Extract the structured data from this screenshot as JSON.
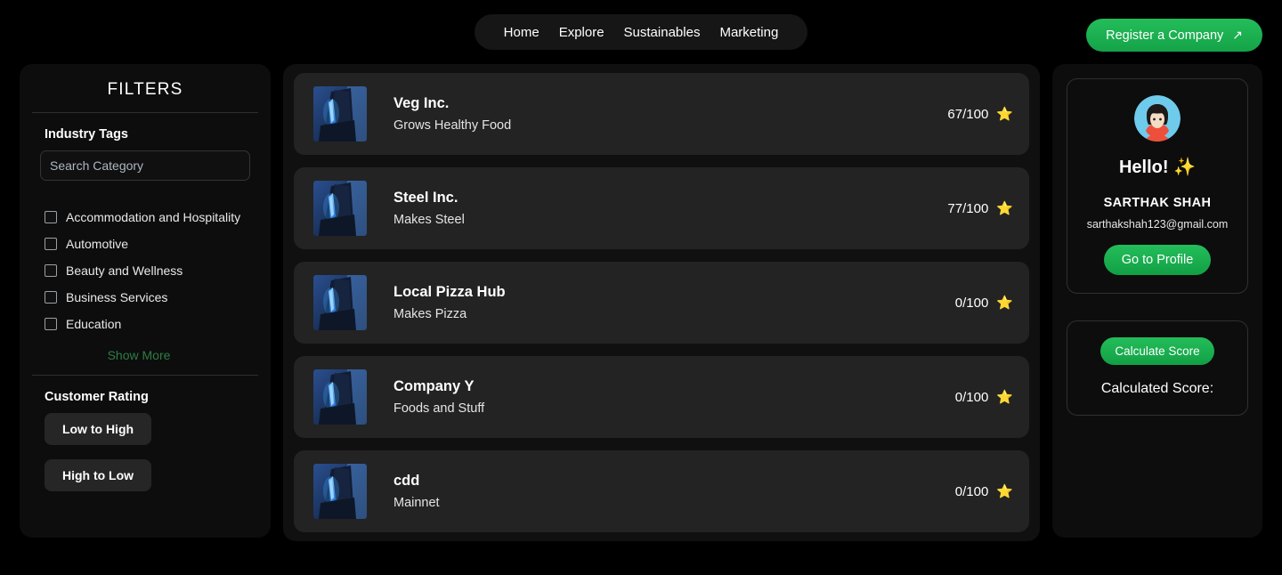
{
  "header": {
    "nav_items": [
      {
        "label": "Home"
      },
      {
        "label": "Explore"
      },
      {
        "label": "Sustainables"
      },
      {
        "label": "Marketing"
      }
    ],
    "register_label": "Register a Company",
    "register_icon": "arrow-up-right-icon",
    "register_arrow": "↗",
    "accent_green": "#1db954"
  },
  "sidebar": {
    "title": "FILTERS",
    "industry_label": "Industry Tags",
    "search": {
      "placeholder": "Search Category",
      "value": ""
    },
    "industry_tags": [
      {
        "label": "Accommodation and Hospitality",
        "checked": false
      },
      {
        "label": "Automotive",
        "checked": false
      },
      {
        "label": "Beauty and Wellness",
        "checked": false
      },
      {
        "label": "Business Services",
        "checked": false
      },
      {
        "label": "Education",
        "checked": false
      }
    ],
    "show_more_label": "Show More",
    "show_more_color": "#2e7d44",
    "rating_label": "Customer Rating",
    "sort_buttons": [
      {
        "label": "Low to High"
      },
      {
        "label": "High to Low"
      }
    ]
  },
  "companies": [
    {
      "name": "Veg Inc.",
      "description": "Grows Healthy Food",
      "score": "67/100",
      "star": "⭐"
    },
    {
      "name": "Steel Inc.",
      "description": "Makes Steel",
      "score": "77/100",
      "star": "⭐"
    },
    {
      "name": "Local Pizza Hub",
      "description": "Makes Pizza",
      "score": "0/100",
      "star": "⭐"
    },
    {
      "name": "Company Y",
      "description": "Foods and Stuff",
      "score": "0/100",
      "star": "⭐"
    },
    {
      "name": "cdd",
      "description": "Mainnet",
      "score": "0/100",
      "star": "⭐"
    }
  ],
  "profile": {
    "avatar_icon": "user-avatar-icon",
    "greeting": "Hello! ✨",
    "name": "SARTHAK SHAH",
    "email": "sarthakshah123@gmail.com",
    "profile_button": "Go to Profile"
  },
  "score_panel": {
    "calculate_button": "Calculate Score",
    "calculated_label": "Calculated Score:",
    "calculated_value": ""
  }
}
